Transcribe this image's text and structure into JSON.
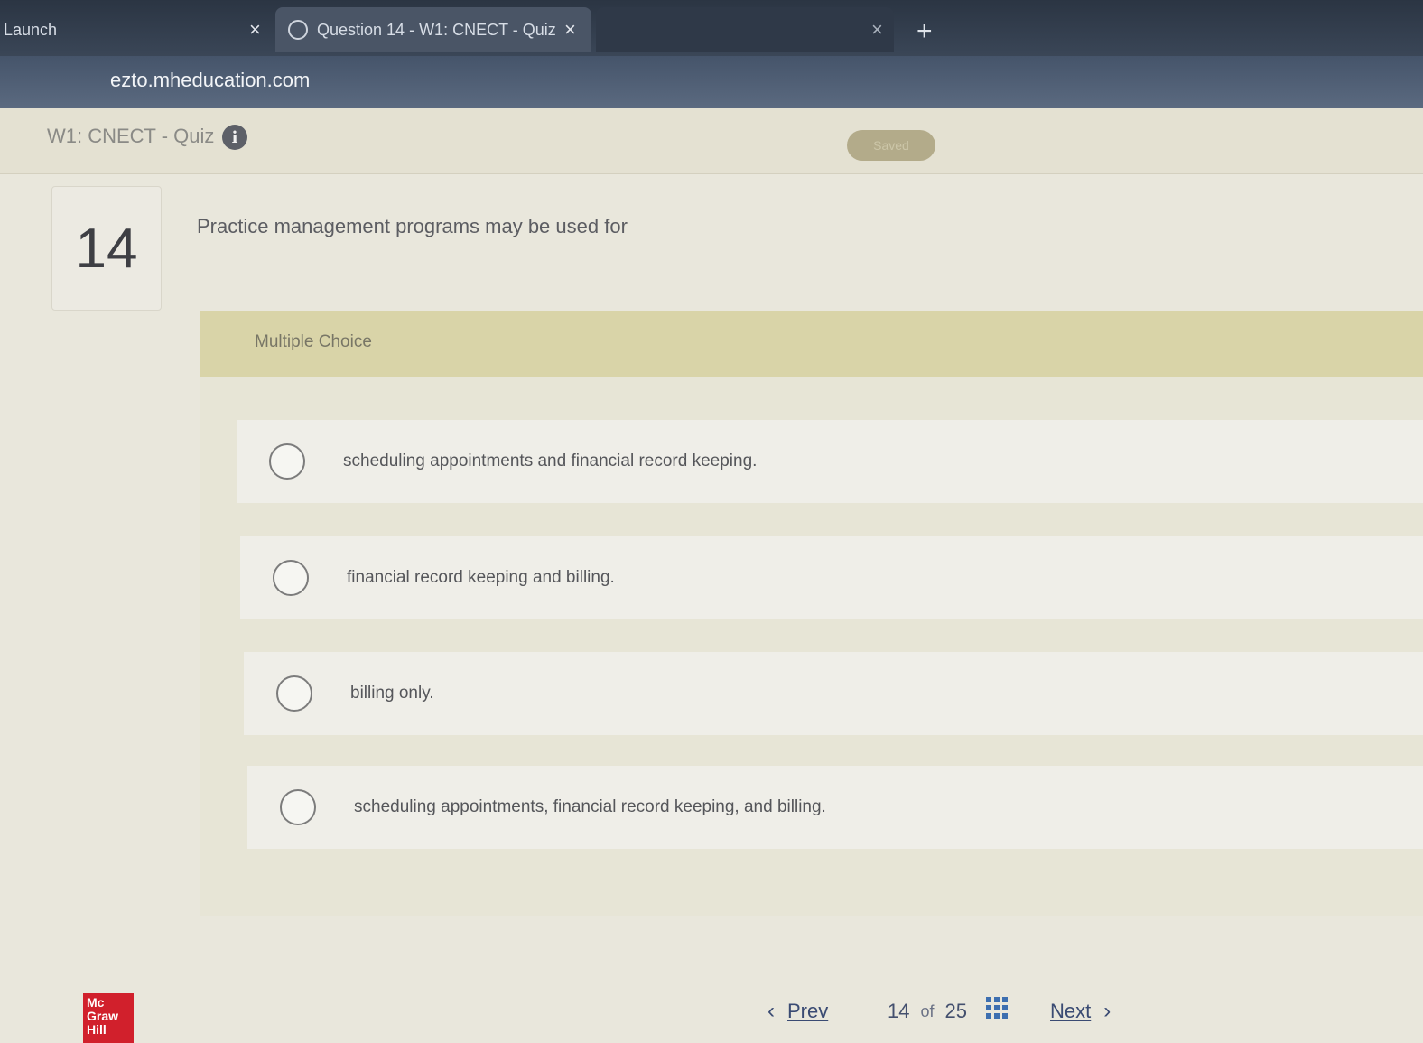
{
  "browser": {
    "tabs": [
      {
        "label": "Launch",
        "close": "×"
      },
      {
        "label": "Question 14 - W1: CNECT - Quiz",
        "close": "×"
      },
      {
        "label": "",
        "close": "×"
      }
    ],
    "new_tab": "+",
    "url": "ezto.mheducation.com"
  },
  "header": {
    "quiz_title": "W1: CNECT - Quiz",
    "info_icon": "i",
    "saved_label": "Saved"
  },
  "question": {
    "number": "14",
    "text": "Practice management programs may be used for",
    "type_label": "Multiple Choice",
    "options": [
      "scheduling appointments and financial record keeping.",
      "financial record keeping and billing.",
      "billing only.",
      "scheduling appointments, financial record keeping, and billing."
    ]
  },
  "footer": {
    "logo_lines": [
      "Mc",
      "Graw",
      "Hill"
    ],
    "prev_icon": "‹",
    "prev_label": "Prev",
    "current": "14",
    "of_label": "of",
    "total": "25",
    "next_label": "Next",
    "next_icon": "›"
  }
}
